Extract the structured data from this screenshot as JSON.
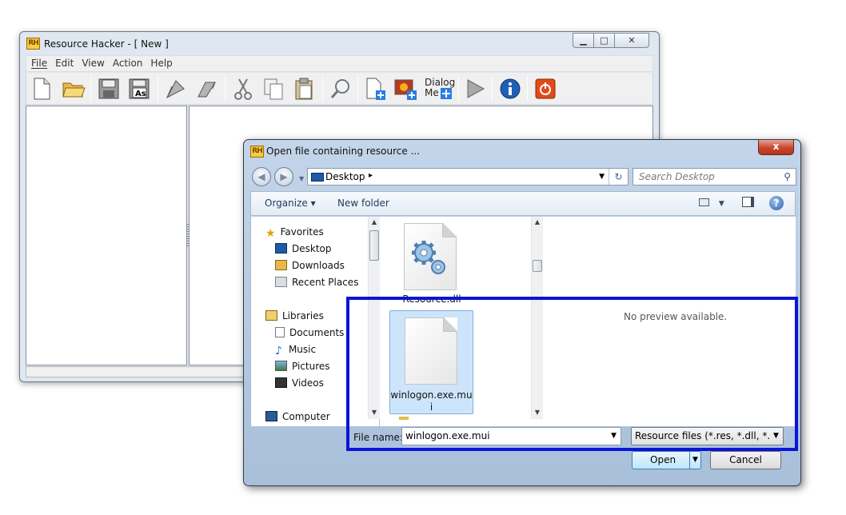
{
  "rh_window": {
    "title": "Resource Hacker - [ New ]",
    "app_icon": "RH",
    "caption_buttons": [
      "▭",
      "□",
      "✕"
    ],
    "menu": [
      "File",
      "Edit",
      "View",
      "Action",
      "Help"
    ],
    "toolbar_icons": [
      "new-file-icon",
      "open-folder-icon",
      "save-icon",
      "save-as-icon",
      "compile-icon",
      "decompile-icon",
      "cut-icon",
      "copy-icon",
      "paste-icon",
      "find-icon",
      "add-resource-icon",
      "add-image-icon",
      "dialog-menu-icon",
      "run-icon",
      "about-icon",
      "exit-icon"
    ],
    "save_as_label": "As",
    "dialog_menu_label": "Dialog Menu",
    "dialog_line1": "Dialog",
    "dialog_line2": "Me"
  },
  "open_dialog": {
    "title": "Open file containing resource ...",
    "app_icon": "RH",
    "close_label": "x",
    "address": {
      "location": "Desktop",
      "arrow": "▸"
    },
    "search_placeholder": "Search Desktop",
    "commands": {
      "organize": "Organize ▾",
      "new_folder": "New folder"
    },
    "nav": {
      "favorites_header": "Favorites",
      "favorites": [
        "Desktop",
        "Downloads",
        "Recent Places"
      ],
      "libraries_header": "Libraries",
      "libraries": [
        "Documents",
        "Music",
        "Pictures",
        "Videos"
      ],
      "computer": "Computer"
    },
    "files": [
      {
        "name": "Resource.dll",
        "selected": false
      },
      {
        "name_line1": "winlogon.exe.mu",
        "name_line2": "i",
        "selected": true
      }
    ],
    "preview_text": "No preview available.",
    "file_name_label": "File name:",
    "file_name_value": "winlogon.exe.mui",
    "filter_value": "Resource files (*.res, *.dll, *.exe,",
    "open_label": "Open",
    "cancel_label": "Cancel"
  },
  "colors": {
    "highlight": "#0a14d6",
    "dialog_frame": "#b4c8e0",
    "selection": "#cde5fb"
  }
}
